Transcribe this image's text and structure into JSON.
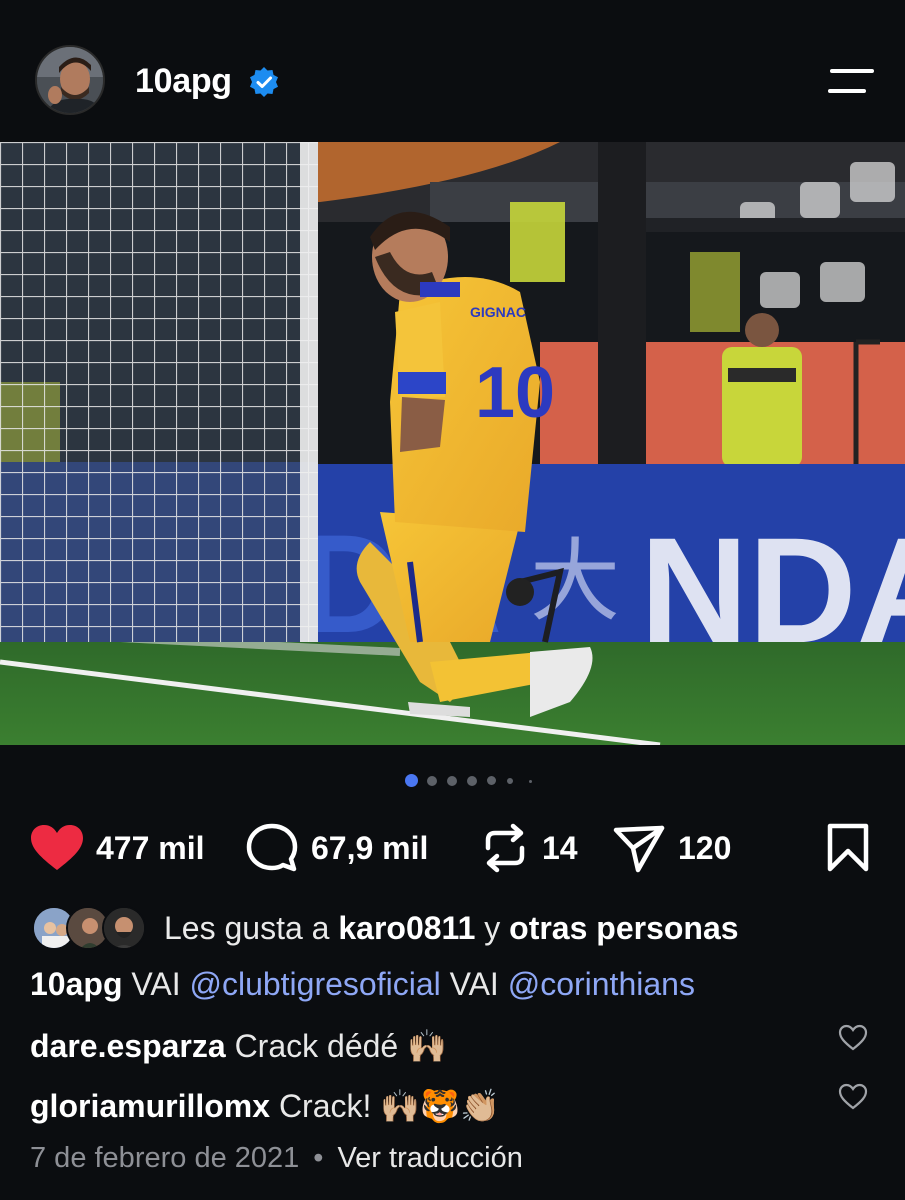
{
  "header": {
    "username": "10apg",
    "verified": true,
    "menu_icon": "menu-icon"
  },
  "post": {
    "image_alt": "Jugador con camiseta amarilla número 10 arrodillado celebrando un gol",
    "jersey_name": "GIGNAC",
    "jersey_number": "10",
    "board_text": "NDA",
    "board_text_left": "DA",
    "carousel": {
      "total": 6,
      "active_index": 0
    }
  },
  "actions": {
    "likes_count": "477 mil",
    "comments_count": "67,9 mil",
    "reposts_count": "14",
    "shares_count": "120",
    "like_color": "#ed2b42"
  },
  "liked_by": {
    "prefix": "Les gusta a",
    "user": "karo0811",
    "connector": "y",
    "others": "otras personas"
  },
  "caption": {
    "user": "10apg",
    "text1": "VAI",
    "mention1": "@clubtigresoficial",
    "text2": "VAI",
    "mention2": "@corinthians"
  },
  "comments": [
    {
      "user": "dare.esparza",
      "text": "Crack dédé 🙌🏼"
    },
    {
      "user": "gloriamurillomx",
      "text": "Crack! 🙌🏼🐯👏🏼"
    }
  ],
  "meta": {
    "date": "7 de febrero de 2021",
    "separator": "•",
    "translate": "Ver traducción"
  }
}
